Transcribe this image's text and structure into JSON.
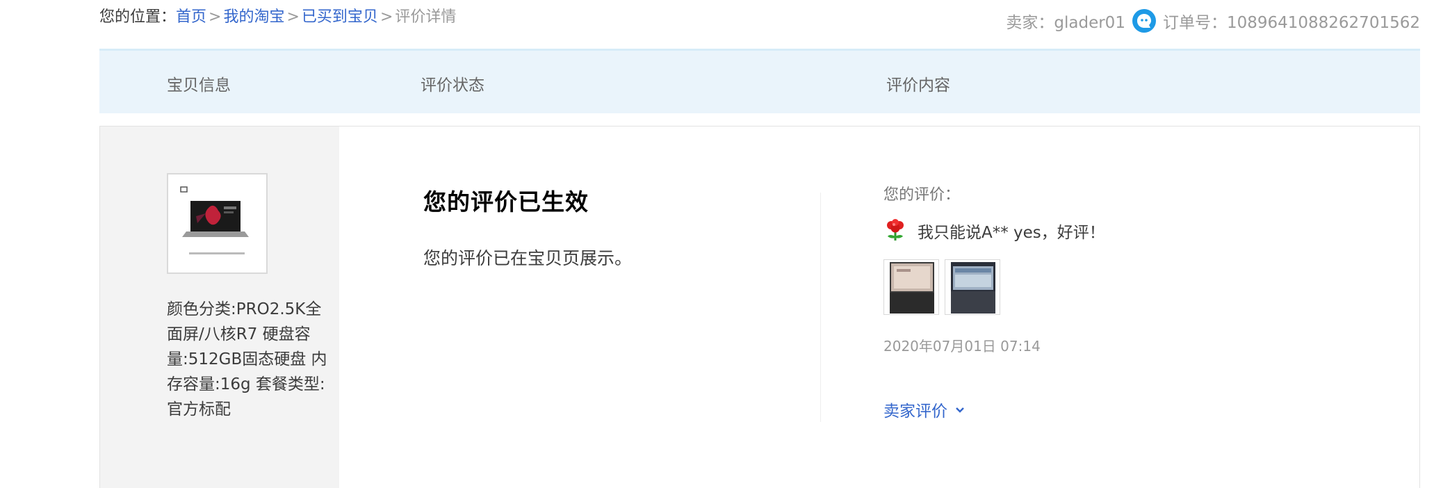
{
  "breadcrumb": {
    "prefix": "您的位置：",
    "items": [
      "首页",
      "我的淘宝",
      "已买到宝贝"
    ],
    "current": "评价详情",
    "separator": ">"
  },
  "order_meta": {
    "seller_label": "卖家：",
    "seller_name": "glader01",
    "order_label": "订单号：",
    "order_no": "1089641088262701562",
    "chat_icon": "aliwangwang-icon"
  },
  "table_header": {
    "col1": "宝贝信息",
    "col2": "评价状态",
    "col3": "评价内容"
  },
  "item": {
    "sku": "颜色分类:PRO2.5K全面屏/八核R7  硬盘容量:512GB固态硬盘  内存容量:16g  套餐类型:官方标配"
  },
  "status": {
    "title": "您的评价已生效",
    "text": "您的评价已在宝贝页展示。"
  },
  "review": {
    "label": "您的评价：",
    "rating_icon": "good-rating-flower-icon",
    "text": "我只能说A** yes，好评！",
    "date": "2020年07月01日 07:14",
    "seller_reply_label": "卖家评价",
    "photo_count": 2
  },
  "colors": {
    "link": "#3366cc",
    "header_bg": "#eaf4fb",
    "left_col_bg": "#f3f3f3"
  }
}
